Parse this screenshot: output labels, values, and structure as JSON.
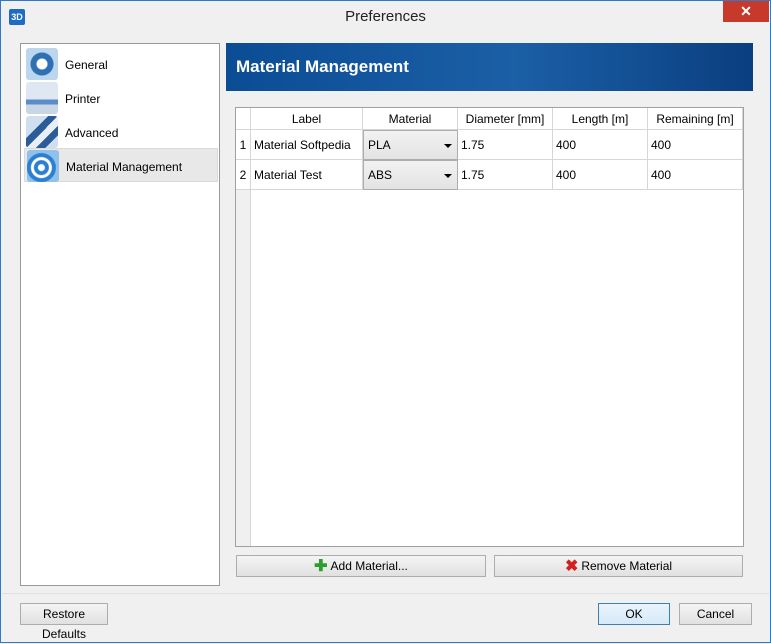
{
  "window": {
    "title": "Preferences",
    "app_icon_text": "3D",
    "close_symbol": "✕"
  },
  "sidebar": {
    "items": [
      {
        "label": "General",
        "icon": "gear-icon",
        "selected": false
      },
      {
        "label": "Printer",
        "icon": "printer-icon",
        "selected": false
      },
      {
        "label": "Advanced",
        "icon": "tools-icon",
        "selected": false
      },
      {
        "label": "Material Management",
        "icon": "filament-spool-icon",
        "selected": true
      }
    ]
  },
  "panel": {
    "title": "Material Management",
    "table": {
      "columns": [
        "Label",
        "Material",
        "Diameter [mm]",
        "Length [m]",
        "Remaining [m]"
      ],
      "rows": [
        {
          "num": "1",
          "label": "Material Softpedia",
          "material": "PLA",
          "diameter": "1.75",
          "length": "400",
          "remaining": "400"
        },
        {
          "num": "2",
          "label": "Material Test",
          "material": "ABS",
          "diameter": "1.75",
          "length": "400",
          "remaining": "400"
        }
      ]
    },
    "add_button": "Add Material...",
    "remove_button": "Remove Material"
  },
  "footer": {
    "restore_button": "Restore Defaults",
    "ok_button": "OK",
    "cancel_button": "Cancel"
  },
  "colors": {
    "accent": "#0b4d94",
    "close": "#c7392b",
    "add": "#2e9e2e",
    "remove": "#d42020"
  }
}
